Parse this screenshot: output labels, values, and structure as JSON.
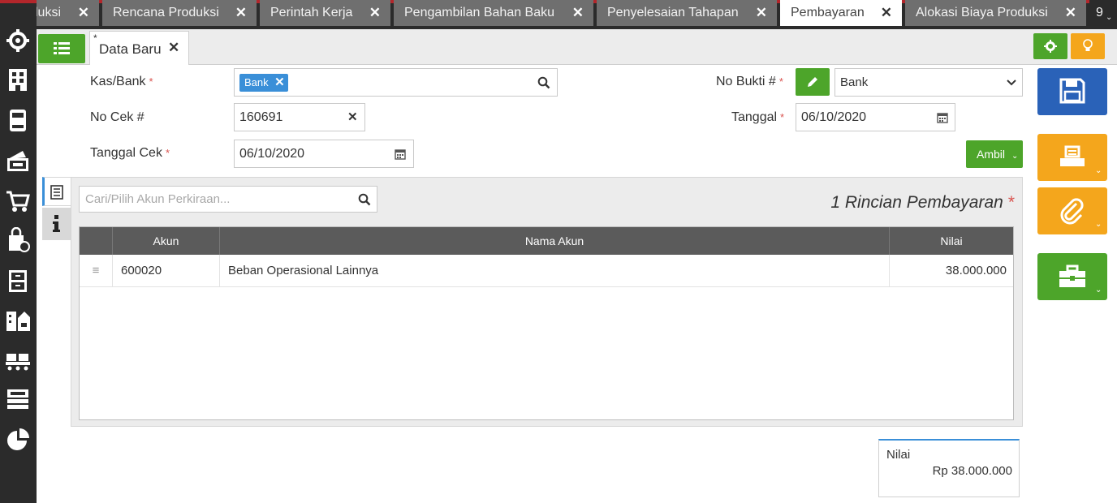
{
  "tabs": [
    {
      "label": "luksi",
      "active": false
    },
    {
      "label": "Rencana Produksi",
      "active": false
    },
    {
      "label": "Perintah Kerja",
      "active": false
    },
    {
      "label": "Pengambilan Bahan Baku",
      "active": false
    },
    {
      "label": "Penyelesaian Tahapan",
      "active": false
    },
    {
      "label": "Pembayaran",
      "active": true
    },
    {
      "label": "Alokasi Biaya Produksi",
      "active": false
    }
  ],
  "tab_overflow": "9",
  "doc_tab": {
    "marker": "*",
    "label": "Data Baru"
  },
  "form": {
    "kas_bank": {
      "label": "Kas/Bank",
      "chip": "Bank"
    },
    "no_cek": {
      "label": "No Cek #",
      "value": "160691"
    },
    "tanggal_cek": {
      "label": "Tanggal Cek",
      "value": "06/10/2020"
    },
    "no_bukti": {
      "label": "No Bukti #",
      "value": "Bank"
    },
    "tanggal": {
      "label": "Tanggal",
      "value": "06/10/2020"
    },
    "required_mark": "*",
    "ambil_label": "Ambil"
  },
  "detail": {
    "search_placeholder": "Cari/Pilih Akun Perkiraan...",
    "title": "1 Rincian Pembayaran",
    "required_mark": "*",
    "columns": [
      "Akun",
      "Nama Akun",
      "Nilai"
    ],
    "rows": [
      {
        "akun": "600020",
        "nama_akun": "Beban Operasional Lainnya",
        "nilai": "38.000.000"
      }
    ]
  },
  "total": {
    "label": "Nilai",
    "value": "Rp 38.000.000"
  },
  "colors": {
    "green": "#4da52a",
    "orange": "#f4a61c",
    "blue": "#2a62b8",
    "dark": "#2b2b2b"
  },
  "icons": {
    "sidebar": [
      "settings-icon",
      "building-icon",
      "calculator-icon",
      "wallet-icon",
      "cart-icon",
      "shopping-bag-icon",
      "archive-icon",
      "city-icon",
      "factory-icon",
      "tax-icon",
      "pie-chart-icon"
    ],
    "toolbar": [
      "list-icon",
      "gear-icon",
      "lightbulb-icon",
      "save-icon",
      "print-icon",
      "attachment-icon",
      "briefcase-icon"
    ]
  }
}
